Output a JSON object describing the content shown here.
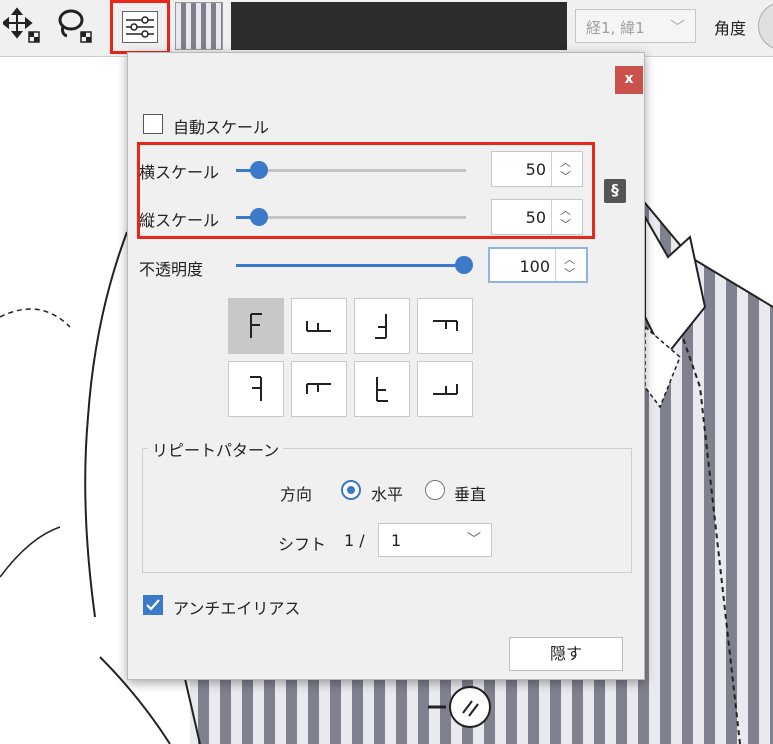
{
  "toolbar": {
    "move_tool_icon": "move-arrows-icon",
    "lasso_tool_icon": "lasso-icon",
    "settings_icon": "sliders-icon",
    "pattern_swatch": "vertical-stripe-pattern",
    "color_bar": "#2d2d2d",
    "weave_select": "経1, 緯1",
    "angle_label": "角度"
  },
  "dialog": {
    "close_label": "x",
    "auto_scale_label": "自動スケール",
    "auto_scale_checked": false,
    "h_scale": {
      "label": "横スケール",
      "value": "50",
      "fraction": 0.1
    },
    "v_scale": {
      "label": "縦スケール",
      "value": "50",
      "fraction": 0.1
    },
    "opacity": {
      "label": "不透明度",
      "value": "100",
      "fraction": 1.0
    },
    "link_icon": "chain-link-icon",
    "orientations": {
      "row1": [
        "F",
        "⊥F (rotated)",
        "flipped F",
        "T-shape"
      ],
      "row2": [
        "mirrored F",
        "rotated F",
        "upside-down F",
        "L-shape"
      ],
      "selected": 0
    },
    "repeat_pattern": {
      "title": "リピートパターン",
      "direction_label": "方向",
      "options": [
        "水平",
        "垂直"
      ],
      "selected": "水平",
      "shift_label": "シフト",
      "shift_prefix": "1 /",
      "shift_value": "1"
    },
    "antialias_label": "アンチエイリアス",
    "antialias_checked": true,
    "hide_button": "隠す"
  },
  "colors": {
    "accent": "#3b79c9",
    "highlight": "#e8261a",
    "close": "#c9524c"
  }
}
